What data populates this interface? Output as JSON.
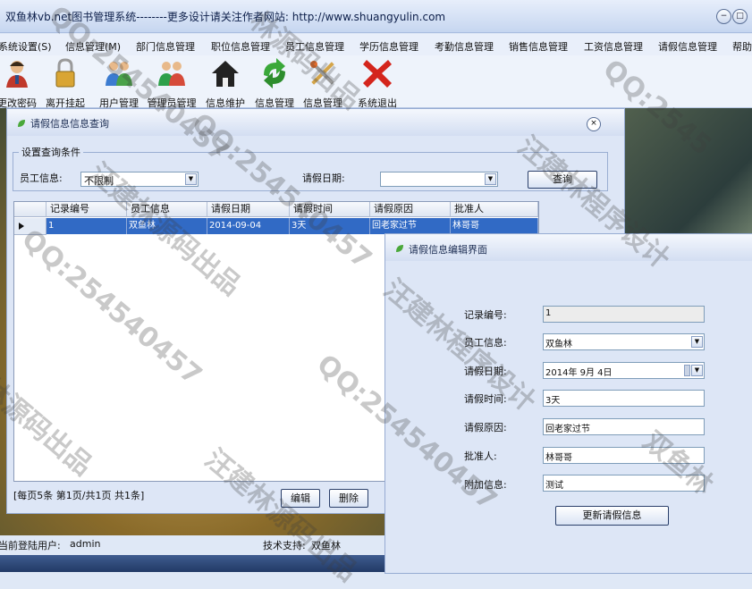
{
  "window": {
    "title": "双鱼林vb.net图书管理系统--------更多设计请关注作者网站:   http://www.shuangyulin.com",
    "min_icon": "−",
    "max_icon": "□"
  },
  "menu": [
    "系统设置(S)",
    "信息管理(M)",
    "部门信息管理",
    "职位信息管理",
    "员工信息管理",
    "学历信息管理",
    "考勤信息管理",
    "销售信息管理",
    "工资信息管理",
    "请假信息管理",
    "帮助"
  ],
  "toolbar": [
    {
      "label": "更改密码",
      "icon": "user-key-icon"
    },
    {
      "label": "离开挂起",
      "icon": "lock-icon"
    },
    {
      "label": "用户管理",
      "icon": "users-icon"
    },
    {
      "label": "管理员管理",
      "icon": "admins-icon"
    },
    {
      "label": "信息维护",
      "icon": "home-icon"
    },
    {
      "label": "信息管理",
      "icon": "refresh-arrow-icon"
    },
    {
      "label": "信息管理",
      "icon": "tools-icon"
    },
    {
      "label": "系统退出",
      "icon": "exit-x-icon"
    }
  ],
  "query_window": {
    "title": "请假信息信息查询",
    "close_icon": "×",
    "conditions_legend": "设置查询条件",
    "employee_label": "员工信息:",
    "employee_value": "不限制",
    "date_label": "请假日期:",
    "date_value": "",
    "query_button": "查询",
    "grid": {
      "columns": [
        "记录编号",
        "员工信息",
        "请假日期",
        "请假时间",
        "请假原因",
        "批准人"
      ],
      "rows": [
        [
          "1",
          "双鱼林",
          "2014-09-04",
          "3天",
          "回老家过节",
          "林哥哥"
        ]
      ]
    },
    "pager_text": "[每页5条  第1页/共1页    共1条]",
    "edit_button": "编辑",
    "delete_button": "删除"
  },
  "edit_window": {
    "title": "请假信息编辑界面",
    "fields": [
      {
        "label": "记录编号:",
        "value": "1"
      },
      {
        "label": "员工信息:",
        "value": "双鱼林"
      },
      {
        "label": "请假日期:",
        "value": "2014年  9月  4日"
      },
      {
        "label": "请假时间:",
        "value": "3天"
      },
      {
        "label": "请假原因:",
        "value": "回老家过节"
      },
      {
        "label": "批准人:",
        "value": "林哥哥"
      },
      {
        "label": "附加信息:",
        "value": "测试"
      }
    ],
    "update_button": "更新请假信息"
  },
  "status": {
    "user_label": "当前登陆用户:",
    "user_value": "admin",
    "support_label": "技术支持:",
    "support_value": "双鱼林"
  },
  "watermarks": [
    "QQ:254540457",
    "汪建林程序设计",
    "林源码出品",
    "QQ:254540457",
    "汪建林源码出品",
    "QQ:254540457",
    "汪建林程序设计",
    "林源码出品",
    "QQ:254540457",
    "双鱼林",
    "汪建林源码出品",
    "QQ:2545"
  ]
}
